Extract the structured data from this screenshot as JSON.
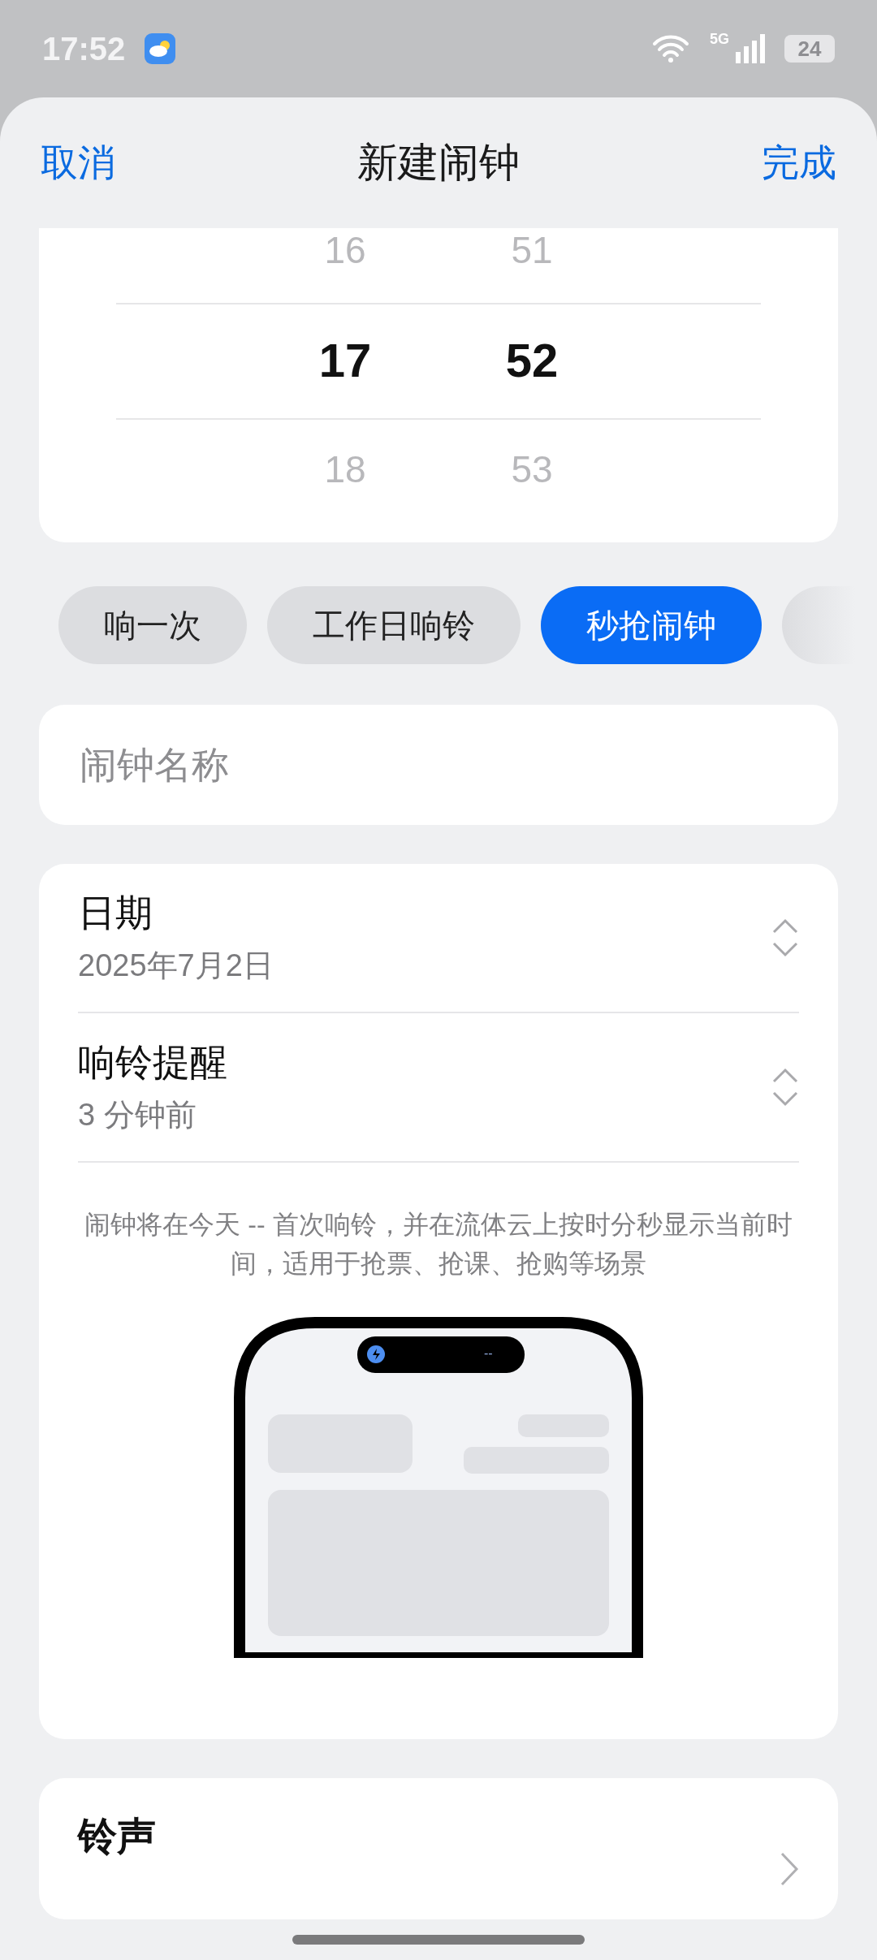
{
  "status_bar": {
    "time": "17:52",
    "network": "5G",
    "battery": "24"
  },
  "header": {
    "cancel": "取消",
    "title": "新建闹钟",
    "done": "完成"
  },
  "time_picker": {
    "columns": [
      {
        "items": [
          {
            "text": "16",
            "selected": false
          },
          {
            "text": "17",
            "selected": true
          },
          {
            "text": "18",
            "selected": false
          }
        ]
      },
      {
        "items": [
          {
            "text": "51",
            "selected": false
          },
          {
            "text": "52",
            "selected": true
          },
          {
            "text": "53",
            "selected": false
          }
        ]
      }
    ]
  },
  "repeat_chips": [
    {
      "label": "响一次",
      "selected": false
    },
    {
      "label": "工作日响铃",
      "selected": false
    },
    {
      "label": "秒抢闹钟",
      "selected": true
    }
  ],
  "name_field": {
    "placeholder": "闹钟名称"
  },
  "settings": [
    {
      "label": "日期",
      "value": "2025年7月2日"
    },
    {
      "label": "响铃提醒",
      "value": "3 分钟前"
    }
  ],
  "description": "闹钟将在今天 -- 首次响铃，并在流体云上按时分秒显示当前时间，适用于抢票、抢课、抢购等场景",
  "preview": {
    "island_text": "--"
  },
  "ringtone": {
    "label": "铃声"
  }
}
